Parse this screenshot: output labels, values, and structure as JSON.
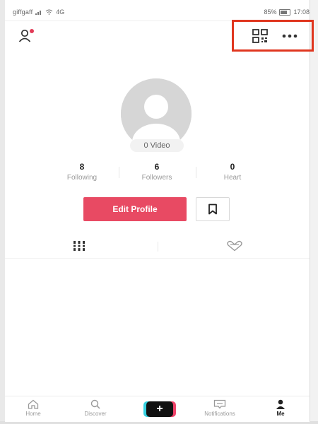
{
  "status_bar": {
    "carrier": "giffgaff",
    "network_text": "4G",
    "battery": "85%",
    "time": "17:08"
  },
  "header": {
    "add_friends_icon": "add-user-icon",
    "qr_icon": "qr-code-icon",
    "more_icon": "more-dots-icon",
    "highlight_color": "#e0361f"
  },
  "profile": {
    "video_count": "0 Video",
    "stats": [
      {
        "value": "8",
        "label": "Following"
      },
      {
        "value": "6",
        "label": "Followers"
      },
      {
        "value": "0",
        "label": "Heart"
      }
    ],
    "edit_profile_label": "Edit Profile",
    "accent_color": "#e84a63"
  },
  "tabs": [
    {
      "icon": "grid-icon"
    },
    {
      "icon": "liked-heart-icon"
    }
  ],
  "bottom_nav": {
    "items": [
      {
        "label": "Home",
        "icon": "home-icon"
      },
      {
        "label": "Discover",
        "icon": "search-icon"
      },
      {
        "label": "Notifications",
        "icon": "message-icon"
      },
      {
        "label": "Me",
        "icon": "person-icon"
      }
    ],
    "create_icon": "plus-icon"
  }
}
